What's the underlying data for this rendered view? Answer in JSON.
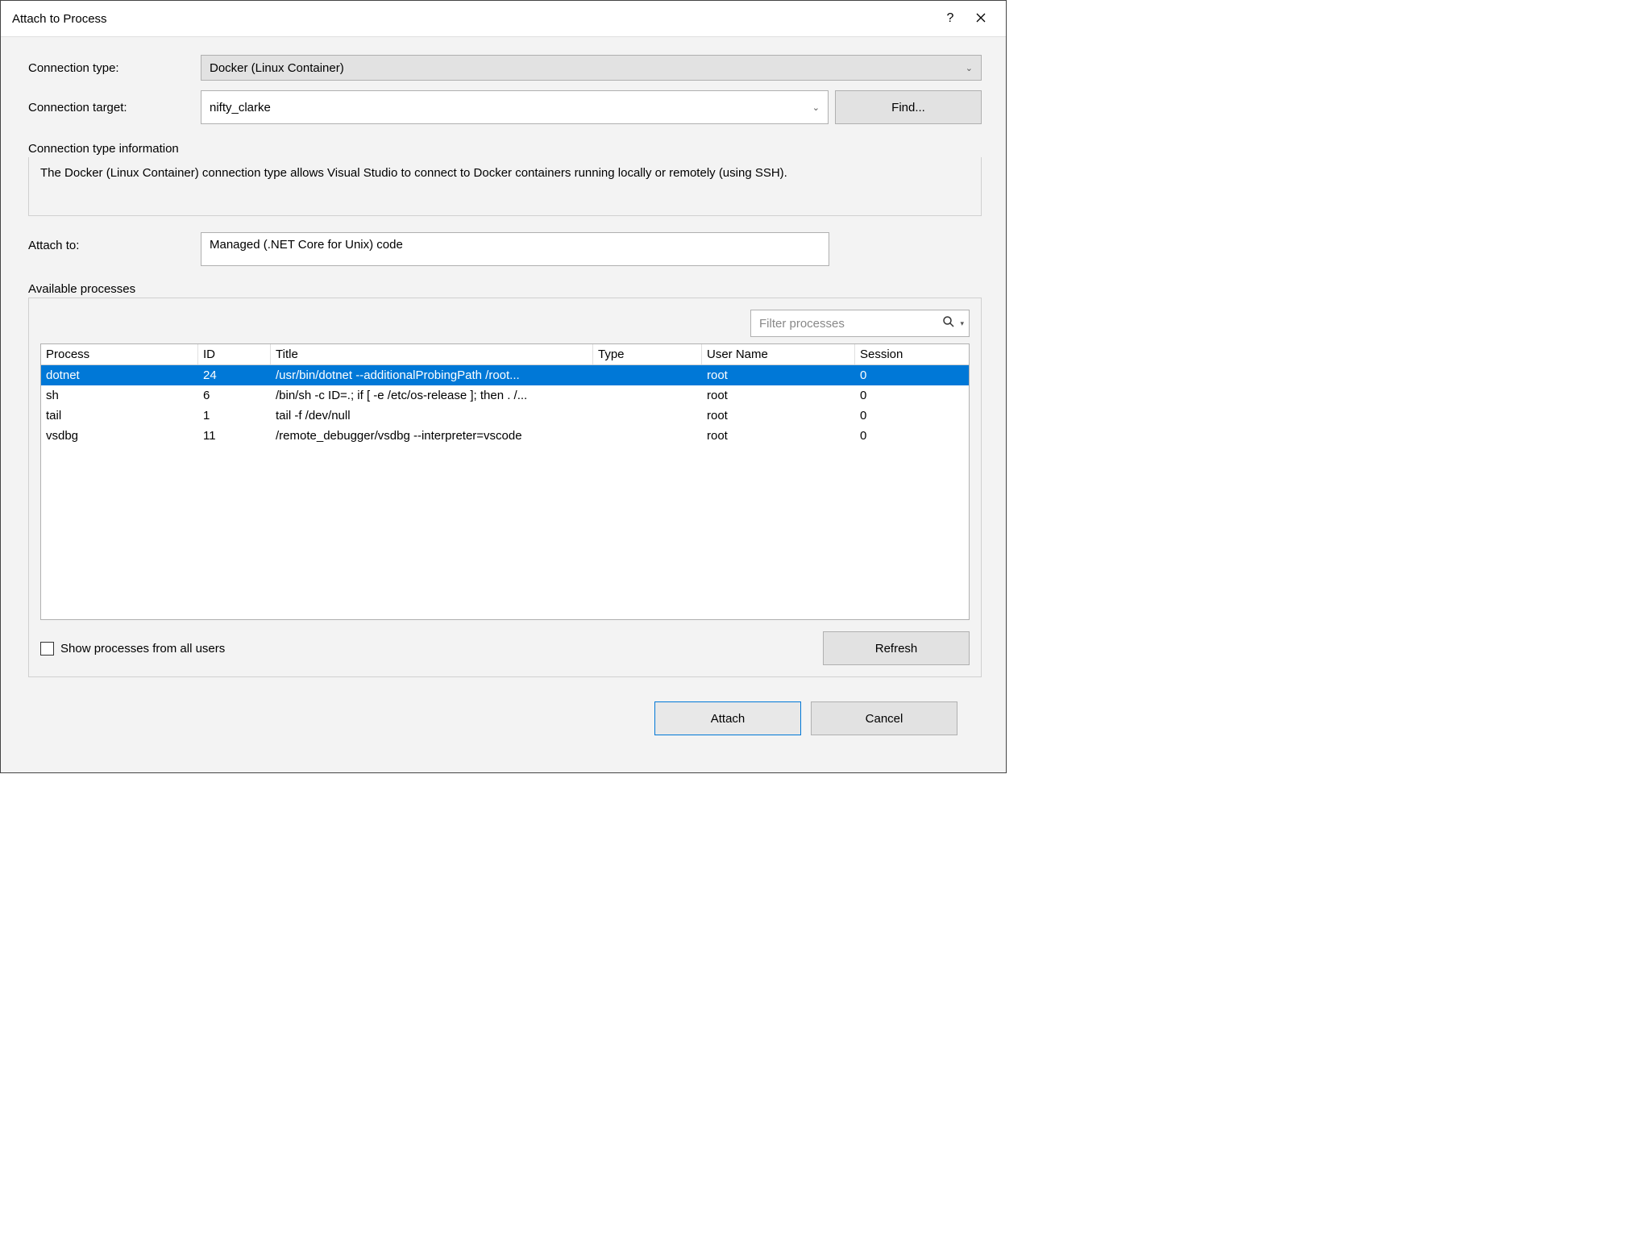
{
  "title": "Attach to Process",
  "labels": {
    "connection_type": "Connection type:",
    "connection_target": "Connection target:",
    "find": "Find...",
    "conn_info_title": "Connection type information",
    "conn_info_text": "The Docker (Linux Container) connection type allows Visual Studio to connect to Docker containers running locally or remotely (using SSH).",
    "attach_to": "Attach to:",
    "available": "Available processes",
    "filter_placeholder": "Filter processes",
    "show_all": "Show processes from all users",
    "refresh": "Refresh",
    "attach": "Attach",
    "cancel": "Cancel"
  },
  "values": {
    "connection_type": "Docker (Linux Container)",
    "connection_target": "nifty_clarke",
    "attach_to": "Managed (.NET Core for Unix) code"
  },
  "columns": {
    "process": "Process",
    "id": "ID",
    "title": "Title",
    "type": "Type",
    "user": "User Name",
    "session": "Session"
  },
  "processes": [
    {
      "process": "dotnet",
      "id": "24",
      "title": "/usr/bin/dotnet --additionalProbingPath /root...",
      "type": "",
      "user": "root",
      "session": "0",
      "selected": true
    },
    {
      "process": "sh",
      "id": "6",
      "title": "/bin/sh -c ID=.; if [ -e /etc/os-release ]; then . /...",
      "type": "",
      "user": "root",
      "session": "0",
      "selected": false
    },
    {
      "process": "tail",
      "id": "1",
      "title": "tail -f /dev/null",
      "type": "",
      "user": "root",
      "session": "0",
      "selected": false
    },
    {
      "process": "vsdbg",
      "id": "11",
      "title": "/remote_debugger/vsdbg --interpreter=vscode",
      "type": "",
      "user": "root",
      "session": "0",
      "selected": false
    }
  ]
}
